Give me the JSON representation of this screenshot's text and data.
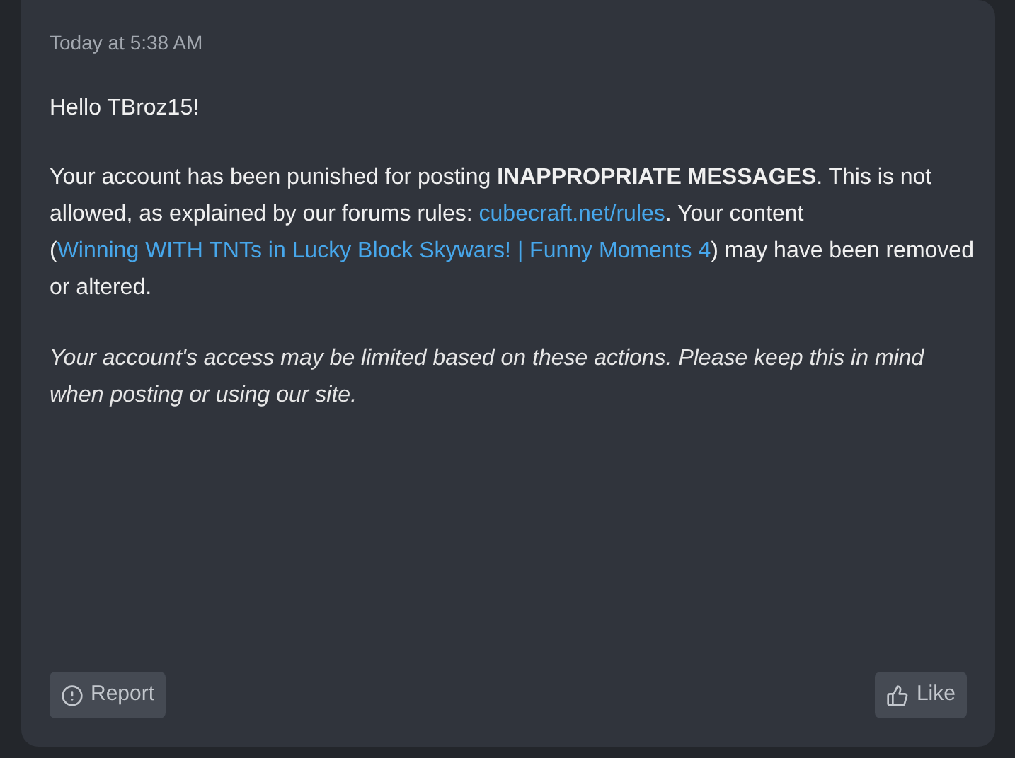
{
  "message": {
    "timestamp": "Today at 5:38 AM",
    "greeting": "Hello TBroz15!",
    "body": [
      {
        "kind": "text",
        "text": "Your account has been punished for posting **INAPPROPRIATE MESSAGES**. This is not allowed, as explained by our forums rules: "
      },
      {
        "kind": "link",
        "text": "cubecraft.net/rules"
      },
      {
        "kind": "text",
        "text": ". Your content ("
      },
      {
        "kind": "link",
        "text": "Winning WITH TNTs in Lucky Block Skywars! | Funny Moments 4"
      },
      {
        "kind": "text",
        "text": ") may have been removed or altered."
      }
    ],
    "notice": "Your account's access may be limited based on these actions. Please keep this in mind when posting or using our site."
  },
  "actions": [
    {
      "kind": "report",
      "label": "Report"
    },
    {
      "kind": "like",
      "label": "Like"
    }
  ]
}
